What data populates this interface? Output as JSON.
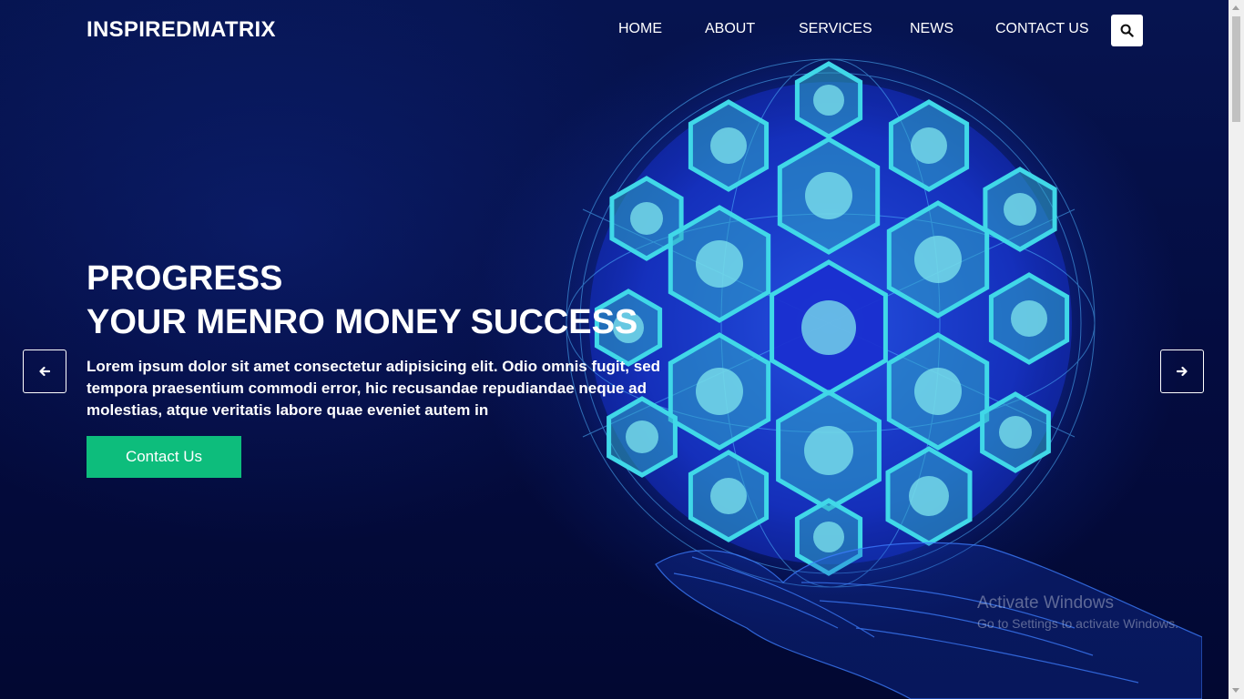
{
  "brand": {
    "logo_text": "INSPIREDMATRIX"
  },
  "nav": {
    "items": [
      {
        "label": "HOME"
      },
      {
        "label": "ABOUT"
      },
      {
        "label": "SERVICES"
      },
      {
        "label": "NEWS"
      },
      {
        "label": "CONTACT US"
      }
    ],
    "search_icon": "search-icon"
  },
  "hero": {
    "title_line1": "PROGRESS",
    "title_line2": "YOUR MENRO MONEY SUCCESS",
    "description": "Lorem ipsum dolor sit amet consectetur adipisicing elit. Odio omnis fugit, sed tempora praesentium commodi error, hic recusandae repudiandae neque ad molestias, atque veritatis labore quae eveniet autem in",
    "cta_label": "Contact Us",
    "prev_icon": "arrow-left-icon",
    "next_icon": "arrow-right-icon",
    "sphere_icons": [
      "ship-icon",
      "handshake-icon",
      "scales-icon",
      "umbrella-icon",
      "clipboard-icon",
      "airplane-icon",
      "piggy-bank-icon",
      "heart-icon",
      "book-icon",
      "shield-icon",
      "lightbulb-icon",
      "home-icon",
      "wallet-icon",
      "medical-kit-icon",
      "family-icon",
      "lifebuoy-icon",
      "briefcase-icon",
      "car-icon",
      "globe-icon"
    ]
  },
  "watermark": {
    "line1": "Activate Windows",
    "line2": "Go to Settings to activate Windows."
  },
  "colors": {
    "accent": "#0dbd7c",
    "background": "#040c40",
    "hex_fill": "#2fa8c8",
    "hex_stroke": "#40d8e8"
  }
}
